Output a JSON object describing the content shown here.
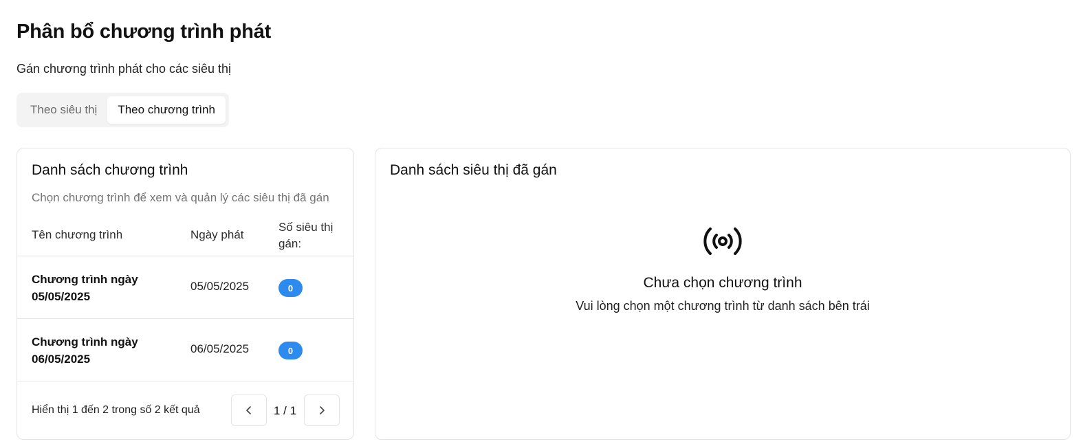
{
  "header": {
    "title": "Phân bổ chương trình phát",
    "subtitle": "Gán chương trình phát cho các siêu thị"
  },
  "tabs": [
    {
      "label": "Theo siêu thị",
      "active": false
    },
    {
      "label": "Theo chương trình",
      "active": true
    }
  ],
  "program_list": {
    "title": "Danh sách chương trình",
    "description": "Chọn chương trình để xem và quản lý các siêu thị đã gán",
    "columns": [
      "Tên chương trình",
      "Ngày phát",
      "Số siêu thị gán:"
    ],
    "rows": [
      {
        "name": "Chương trình ngày 05/05/2025",
        "date": "05/05/2025",
        "count": "0"
      },
      {
        "name": "Chương trình ngày 06/05/2025",
        "date": "06/05/2025",
        "count": "0"
      }
    ],
    "footer": "Hiển thị 1 đến 2 trong số 2 kết quả",
    "page_info": "1 / 1"
  },
  "store_list": {
    "title": "Danh sách siêu thị đã gán",
    "empty_icon": "broadcast-icon",
    "empty_title": "Chưa chọn chương trình",
    "empty_description": "Vui lòng chọn một chương trình từ danh sách bên trái"
  },
  "colors": {
    "badge": "#2d8bf0",
    "border": "#e4e4e7",
    "tab_bg": "#f3f3f3"
  }
}
